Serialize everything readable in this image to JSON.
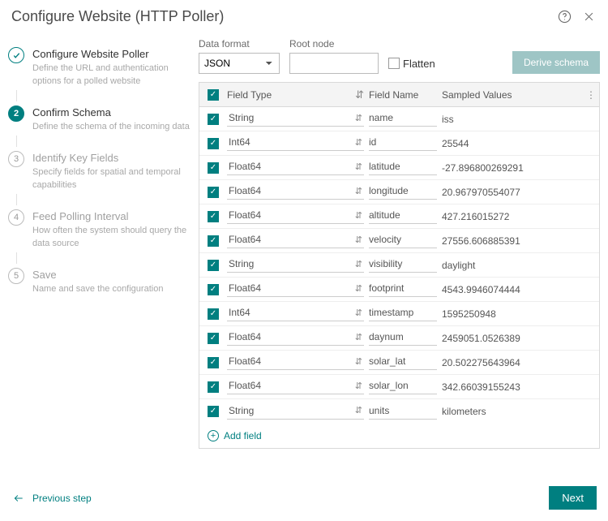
{
  "header": {
    "title": "Configure Website (HTTP Poller)"
  },
  "steps": [
    {
      "num": "1",
      "title": "Configure Website Poller",
      "desc": "Define the URL and authentication options for a polled website",
      "state": "done"
    },
    {
      "num": "2",
      "title": "Confirm Schema",
      "desc": "Define the schema of the incoming data",
      "state": "active"
    },
    {
      "num": "3",
      "title": "Identify Key Fields",
      "desc": "Specify fields for spatial and temporal capabilities",
      "state": "pending"
    },
    {
      "num": "4",
      "title": "Feed Polling Interval",
      "desc": "How often the system should query the data source",
      "state": "pending"
    },
    {
      "num": "5",
      "title": "Save",
      "desc": "Name and save the configuration",
      "state": "pending"
    }
  ],
  "form": {
    "data_format_label": "Data format",
    "data_format_value": "JSON",
    "root_node_label": "Root node",
    "root_node_value": "",
    "flatten_label": "Flatten",
    "flatten_checked": false,
    "derive_schema_label": "Derive schema"
  },
  "table": {
    "header_type": "Field Type",
    "header_name": "Field Name",
    "header_sampled": "Sampled Values",
    "add_field_label": "Add field"
  },
  "fields": [
    {
      "type": "String",
      "name": "name",
      "sample": "iss"
    },
    {
      "type": "Int64",
      "name": "id",
      "sample": "25544"
    },
    {
      "type": "Float64",
      "name": "latitude",
      "sample": "-27.896800269291"
    },
    {
      "type": "Float64",
      "name": "longitude",
      "sample": "20.967970554077"
    },
    {
      "type": "Float64",
      "name": "altitude",
      "sample": "427.216015272"
    },
    {
      "type": "Float64",
      "name": "velocity",
      "sample": "27556.606885391"
    },
    {
      "type": "String",
      "name": "visibility",
      "sample": "daylight"
    },
    {
      "type": "Float64",
      "name": "footprint",
      "sample": "4543.9946074444"
    },
    {
      "type": "Int64",
      "name": "timestamp",
      "sample": "1595250948"
    },
    {
      "type": "Float64",
      "name": "daynum",
      "sample": "2459051.0526389"
    },
    {
      "type": "Float64",
      "name": "solar_lat",
      "sample": "20.502275643964"
    },
    {
      "type": "Float64",
      "name": "solar_lon",
      "sample": "342.66039155243"
    },
    {
      "type": "String",
      "name": "units",
      "sample": "kilometers"
    }
  ],
  "footer": {
    "prev_label": "Previous step",
    "next_label": "Next"
  }
}
